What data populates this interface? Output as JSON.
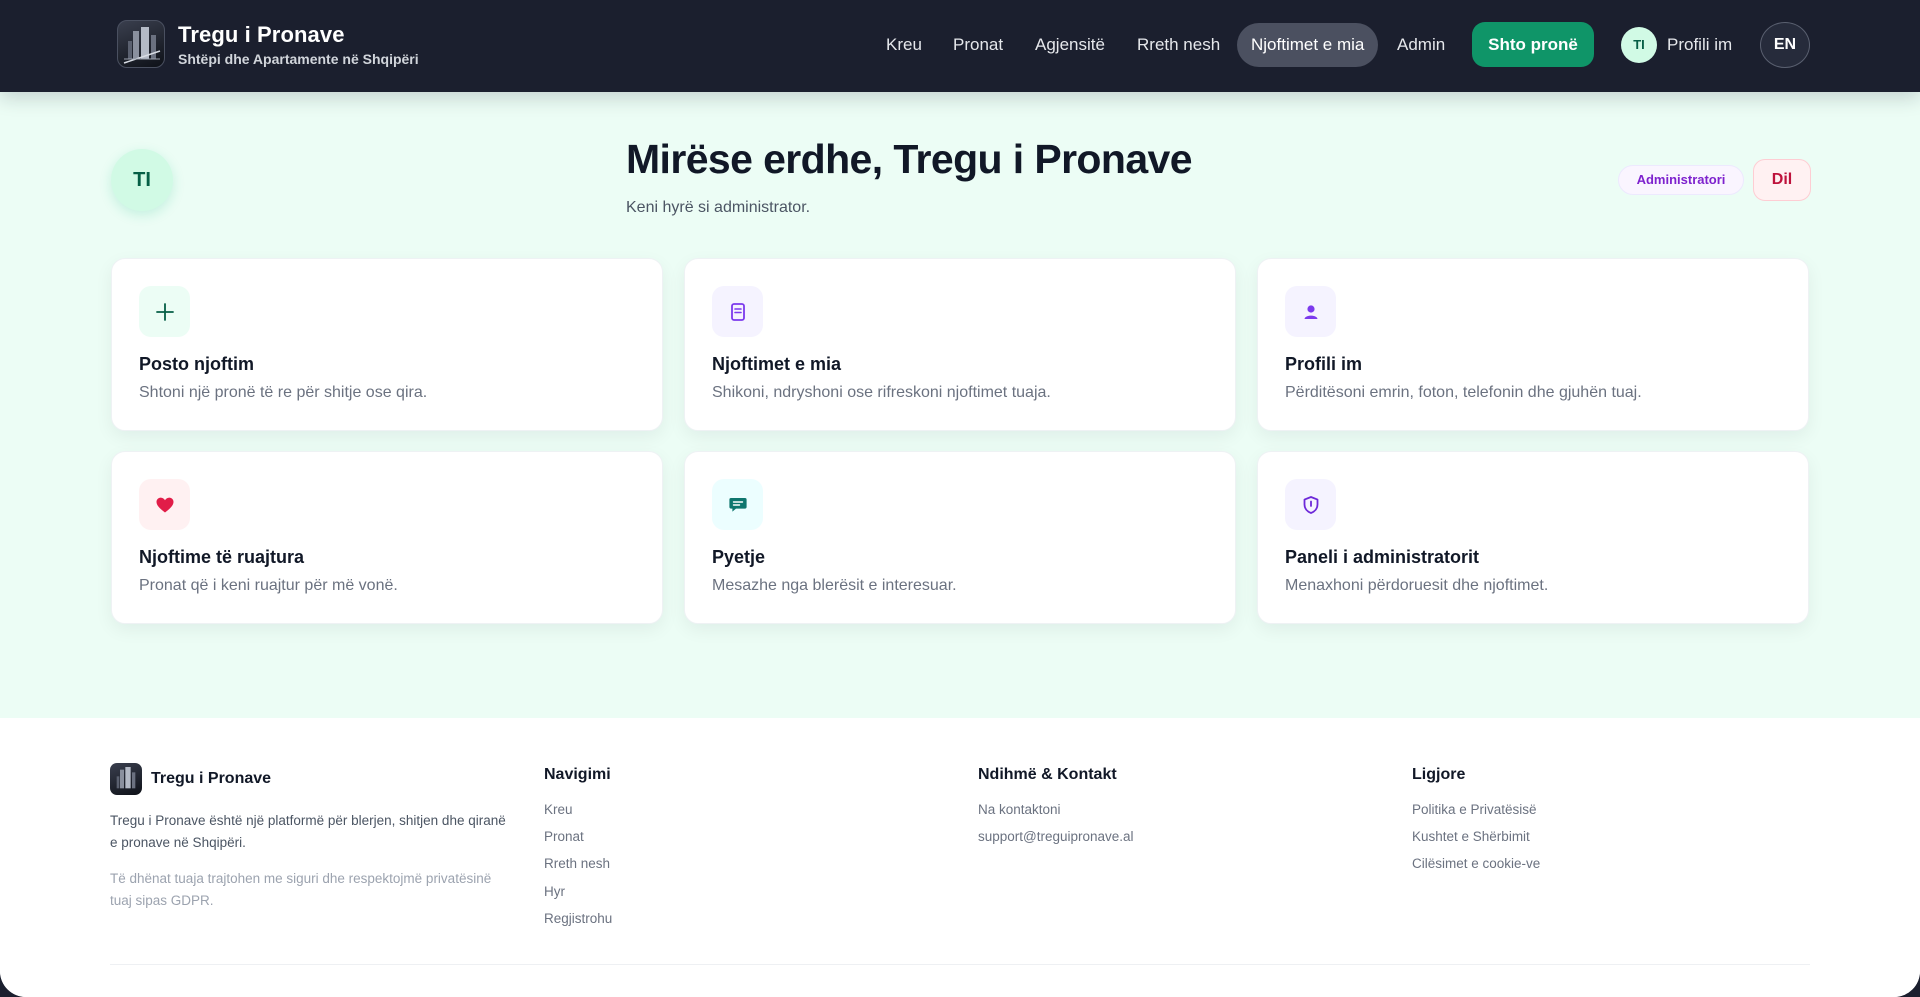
{
  "header": {
    "brand_title": "Tregu i Pronave",
    "brand_subtitle": "Shtëpi dhe Apartamente në Shqipëri",
    "nav": [
      {
        "label": "Kreu",
        "active": false
      },
      {
        "label": "Pronat",
        "active": false
      },
      {
        "label": "Agjensitë",
        "active": false
      },
      {
        "label": "Rreth nesh",
        "active": false
      },
      {
        "label": "Njoftimet e mia",
        "active": true
      },
      {
        "label": "Admin",
        "active": false
      }
    ],
    "cta_label": "Shto pronë",
    "avatar_initials": "TI",
    "profile_label": "Profili im",
    "language": "EN"
  },
  "welcome": {
    "avatar_initials": "TI",
    "title": "Mirëse erdhe, Tregu i Pronave",
    "subtitle": "Keni hyrë si administrator.",
    "role_badge": "Administratori",
    "logout_label": "Dil"
  },
  "cards": [
    {
      "icon": "plus-icon",
      "title": "Posto njoftim",
      "description": "Shtoni një pronë të re për shitje ose qira.",
      "icon_bg": "#ecfdf5",
      "icon_color": "#065f46"
    },
    {
      "icon": "document-icon",
      "title": "Njoftimet e mia",
      "description": "Shikoni, ndryshoni ose rifreskoni njoftimet tuaja.",
      "icon_bg": "#f5f3ff",
      "icon_color": "#7c3aed"
    },
    {
      "icon": "user-icon",
      "title": "Profili im",
      "description": "Përditësoni emrin, foton, telefonin dhe gjuhën tuaj.",
      "icon_bg": "#f5f3ff",
      "icon_color": "#7c3aed"
    },
    {
      "icon": "heart-icon",
      "title": "Njoftime të ruajtura",
      "description": "Pronat që i keni ruajtur për më vonë.",
      "icon_bg": "#fff1f2",
      "icon_color": "#e11d48"
    },
    {
      "icon": "chat-icon",
      "title": "Pyetje",
      "description": "Mesazhe nga blerësit e interesuar.",
      "icon_bg": "#ecfeff",
      "icon_color": "#0f766e"
    },
    {
      "icon": "shield-icon",
      "title": "Paneli i administratorit",
      "description": "Menaxhoni përdoruesit dhe njoftimet.",
      "icon_bg": "#f5f3ff",
      "icon_color": "#6d28d9"
    }
  ],
  "footer": {
    "brand": "Tregu i Pronave",
    "about": "Tregu i Pronave është një platformë për blerjen, shitjen dhe qiranë e pronave në Shqipëri.",
    "privacy_note": "Të dhënat tuaja trajtohen me siguri dhe respektojmë privatësinë tuaj sipas GDPR.",
    "columns": [
      {
        "title": "Navigimi",
        "links": [
          "Kreu",
          "Pronat",
          "Rreth nesh",
          "Hyr",
          "Regjistrohu"
        ]
      },
      {
        "title": "Ndihmë & Kontakt",
        "links": [
          "Na kontaktoni",
          "support@treguipronave.al"
        ]
      },
      {
        "title": "Ligjore",
        "links": [
          "Politika e Privatësisë",
          "Kushtet e Shërbimit",
          "Cilësimet e cookie-ve"
        ]
      }
    ]
  }
}
